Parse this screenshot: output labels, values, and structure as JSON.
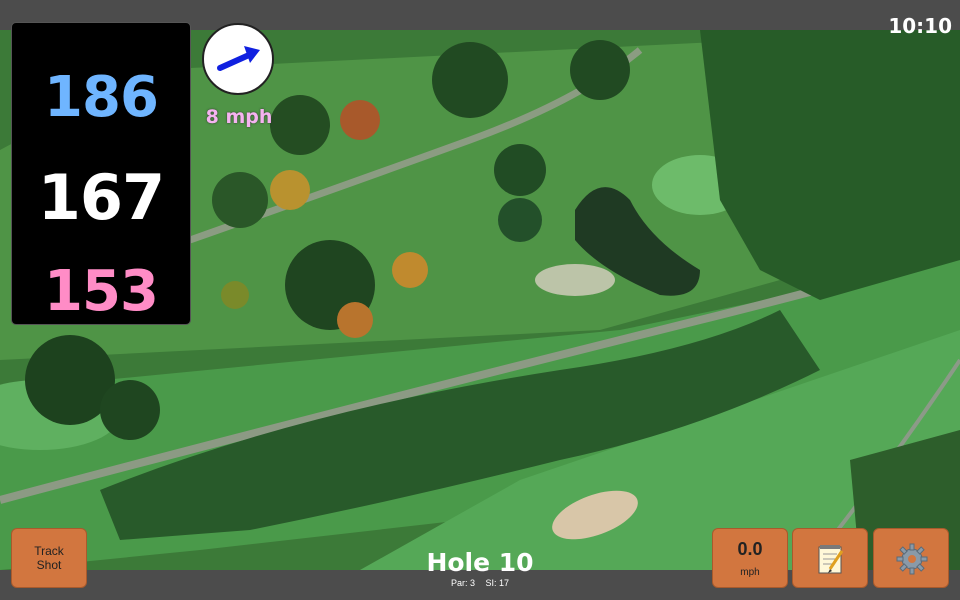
{
  "status": {
    "clock": "10:10"
  },
  "distances": {
    "back": "186",
    "middle": "167",
    "front": "153"
  },
  "wind": {
    "speed": "8 mph",
    "icon": "wind-direction-arrow-icon"
  },
  "hole": {
    "title": "Hole 10",
    "par_label": "Par: 3",
    "si_label": "SI: 17"
  },
  "buttons": {
    "track_line1": "Track",
    "track_line2": "Shot",
    "speed_value": "0.0",
    "speed_unit": "mph",
    "notes_icon": "notepad-icon",
    "settings_icon": "gear-icon"
  },
  "colors": {
    "back_distance": "#6fb5ff",
    "middle_distance": "#ffffff",
    "front_distance": "#ff8cc6",
    "button": "#d2763f",
    "wind_text": "#f5b3f0"
  }
}
